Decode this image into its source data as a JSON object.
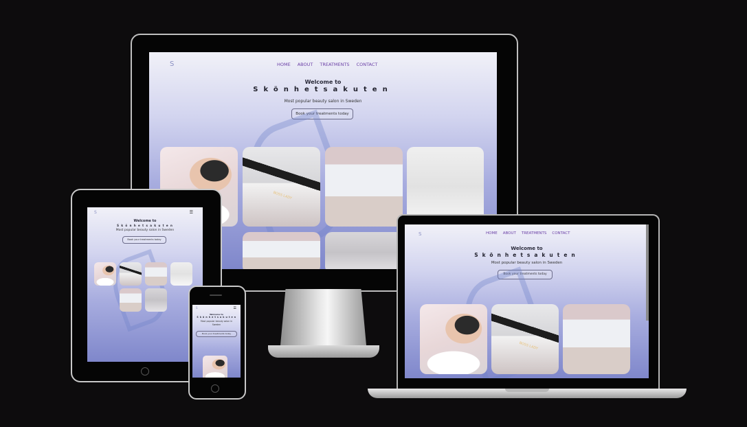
{
  "site": {
    "nav": [
      "HOME",
      "ABOUT",
      "TREATMENTS",
      "CONTACT"
    ],
    "welcome": "Welcome to",
    "brand": "Skönhetsakuten",
    "brand_spaced": "S k ö n h e t s a k u t e n",
    "tagline": "Most popular beauty salon in Sweden",
    "cta": "Book your treatments today",
    "logo": "S",
    "menu_icon": "☰"
  },
  "photos": {
    "plaque": "BOSS LADY"
  },
  "colors": {
    "background": "#0d0c0d",
    "nav_link": "#6a3fa6",
    "gradient_top": "#f1f1f8",
    "gradient_bottom": "#7f87cb"
  }
}
